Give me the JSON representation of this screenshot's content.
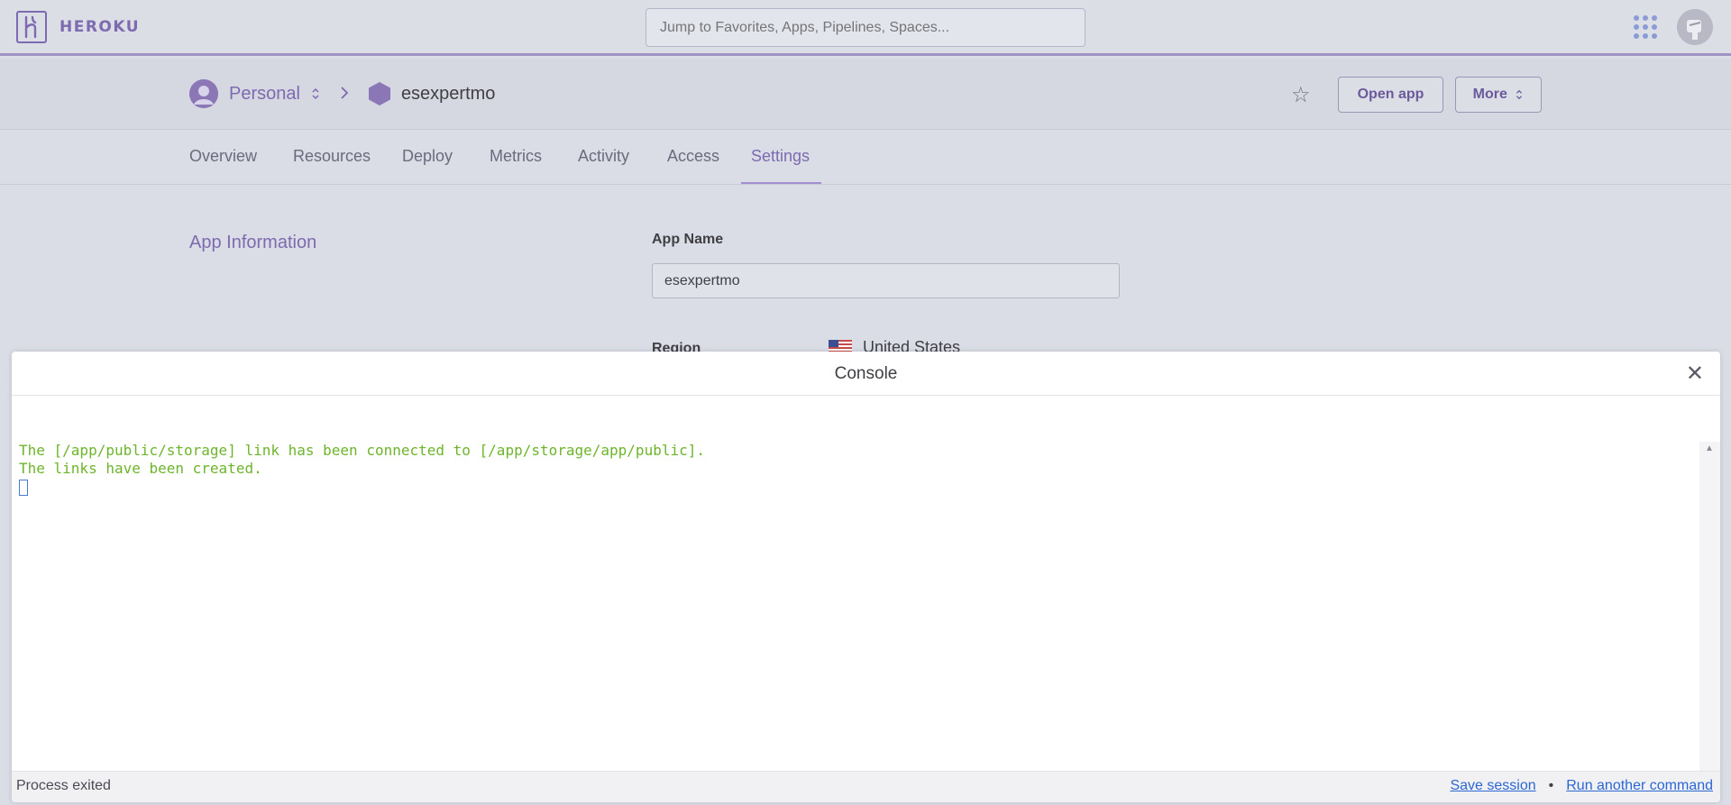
{
  "topnav": {
    "brand": "HEROKU",
    "search_placeholder": "Jump to Favorites, Apps, Pipelines, Spaces..."
  },
  "breadcrumb": {
    "account": "Personal",
    "app": "esexpertmo"
  },
  "header_actions": {
    "open_app": "Open app",
    "more": "More"
  },
  "tabs": [
    {
      "label": "Overview"
    },
    {
      "label": "Resources"
    },
    {
      "label": "Deploy"
    },
    {
      "label": "Metrics"
    },
    {
      "label": "Activity"
    },
    {
      "label": "Access"
    },
    {
      "label": "Settings"
    }
  ],
  "active_tab": "Settings",
  "settings": {
    "section_title": "App Information",
    "app_name_label": "App Name",
    "app_name_value": "esexpertmo",
    "region_label": "Region",
    "region_value": "United States"
  },
  "console": {
    "title": "Console",
    "output_lines": [
      "The [/app/public/storage] link has been connected to [/app/storage/app/public].",
      "The links have been created."
    ],
    "status": "Process exited",
    "save_session": "Save session",
    "separator": "•",
    "run_another": "Run another command"
  },
  "colors": {
    "brand_purple": "#7d6ab0",
    "terminal_green": "#6eb42b",
    "link_blue": "#2b67d3"
  }
}
